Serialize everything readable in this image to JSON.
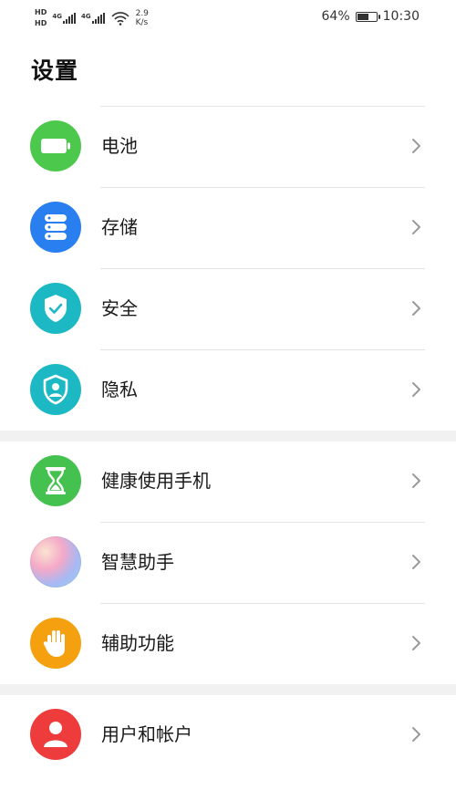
{
  "status_bar": {
    "sim1": "HD",
    "sim2": "HD",
    "net1": "4G",
    "net2": "4G",
    "speed_value": "2.9",
    "speed_unit": "K/s",
    "battery_percent": "64%",
    "battery_level": 0.64,
    "time": "10:30"
  },
  "header": {
    "title": "设置"
  },
  "groups": [
    {
      "items": [
        {
          "label": "电池",
          "icon": "battery-icon",
          "color": "#4cc94c"
        },
        {
          "label": "存储",
          "icon": "storage-icon",
          "color": "#2a7ff0"
        },
        {
          "label": "安全",
          "icon": "shield-check-icon",
          "color": "#1cb9c4"
        },
        {
          "label": "隐私",
          "icon": "privacy-icon",
          "color": "#1cb9c4"
        }
      ]
    },
    {
      "items": [
        {
          "label": "健康使用手机",
          "icon": "hourglass-icon",
          "color": "#44c14e"
        },
        {
          "label": "智慧助手",
          "icon": "assistant-icon",
          "color": "#c9a7ef"
        },
        {
          "label": "辅助功能",
          "icon": "hand-icon",
          "color": "#f5a00f"
        }
      ]
    },
    {
      "items": [
        {
          "label": "用户和帐户",
          "icon": "user-icon",
          "color": "#ee3b3b"
        }
      ]
    }
  ]
}
